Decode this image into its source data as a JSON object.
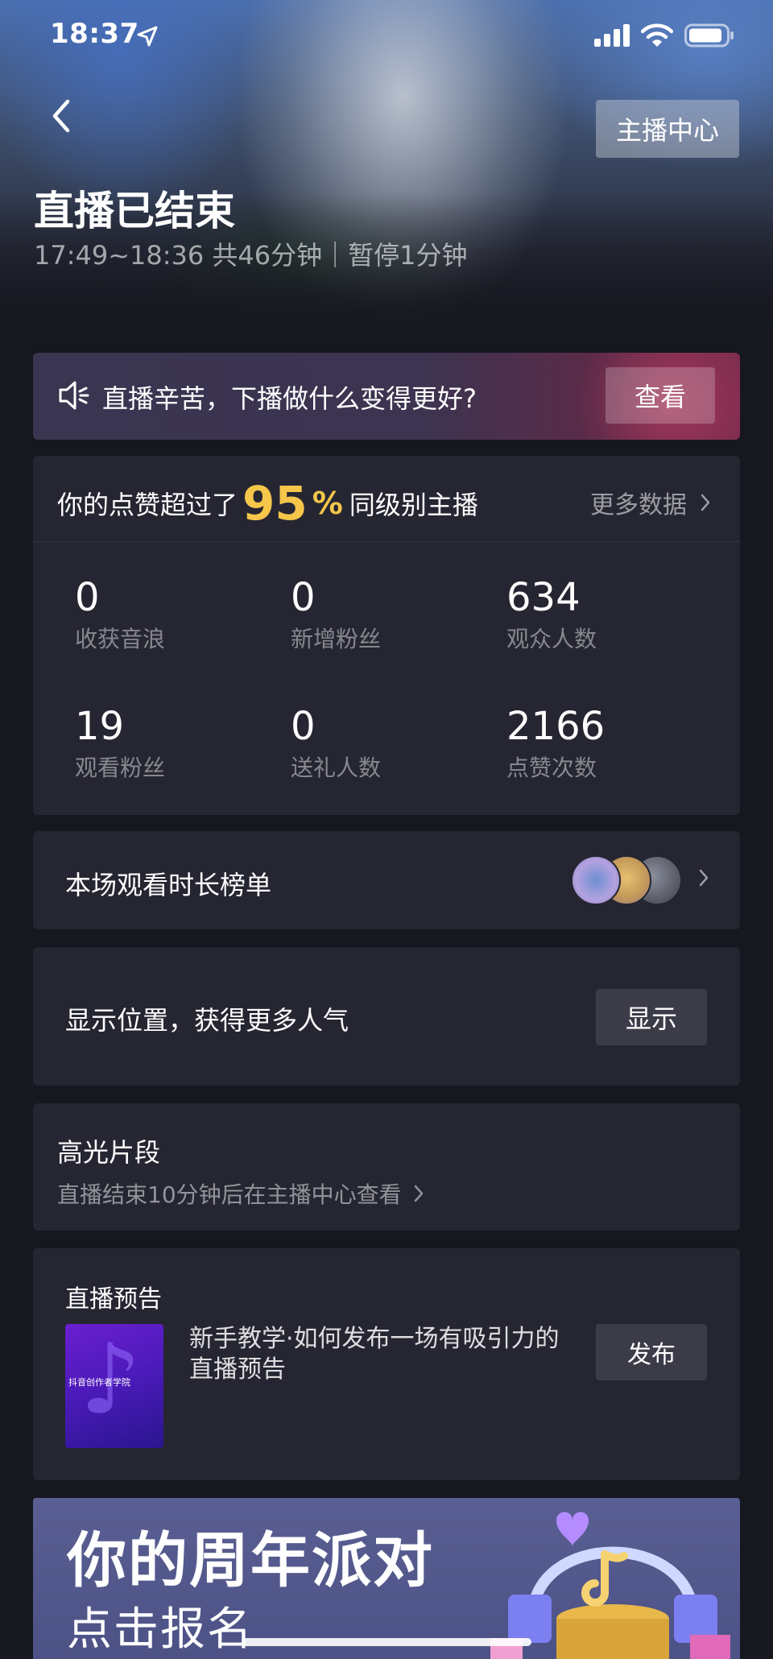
{
  "status_bar": {
    "time": "18:37"
  },
  "header": {
    "anchor_center_label": "主播中心",
    "title": "直播已结束",
    "subtitle": "17:49~18:36 共46分钟｜暂停1分钟"
  },
  "tip_banner": {
    "text": "直播辛苦，下播做什么变得更好?",
    "button_label": "查看"
  },
  "stats": {
    "likes_prefix": "你的点赞超过了",
    "likes_percent": "95",
    "likes_percent_sign": "%",
    "likes_suffix": "同级别主播",
    "more_data_label": "更多数据",
    "items": [
      {
        "value": "0",
        "label": "收获音浪"
      },
      {
        "value": "0",
        "label": "新增粉丝"
      },
      {
        "value": "634",
        "label": "观众人数"
      },
      {
        "value": "19",
        "label": "观看粉丝"
      },
      {
        "value": "0",
        "label": "送礼人数"
      },
      {
        "value": "2166",
        "label": "点赞次数"
      }
    ]
  },
  "ranking": {
    "title": "本场观看时长榜单"
  },
  "location": {
    "text": "显示位置，获得更多人气",
    "button_label": "显示"
  },
  "highlight": {
    "title": "高光片段",
    "subtitle": "直播结束10分钟后在主播中心查看"
  },
  "preview": {
    "title": "直播预告",
    "thumbnail_text": "抖音创作者学院",
    "description": "新手教学·如何发布一场有吸引力的直播预告",
    "button_label": "发布"
  },
  "party_banner": {
    "title": "你的周年派对",
    "cta": "点击报名"
  },
  "colors": {
    "accent_gold": "#f6c64a",
    "card_bg": "#252632",
    "page_bg": "#16171f"
  }
}
